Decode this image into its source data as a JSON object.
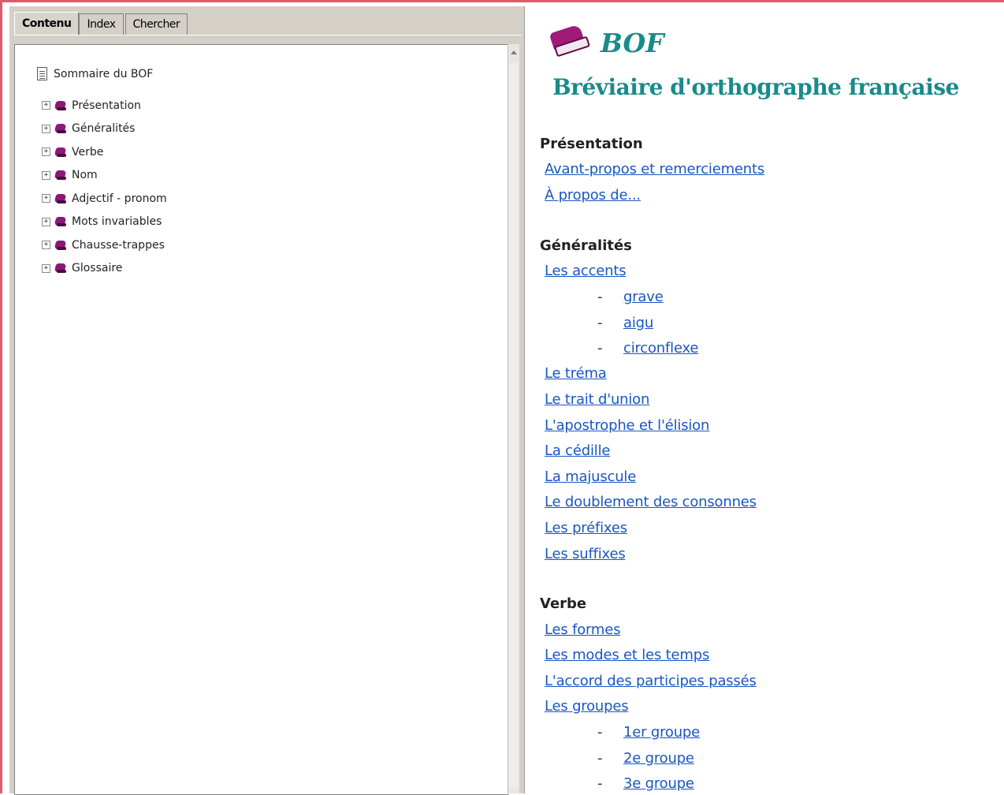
{
  "tabs": [
    "Contenu",
    "Index",
    "Chercher"
  ],
  "tree": {
    "root": "Sommaire du BOF",
    "items": [
      "Présentation",
      "Généralités",
      "Verbe",
      "Nom",
      "Adjectif - pronom",
      "Mots invariables",
      "Chausse-trappes",
      "Glossaire"
    ],
    "expander_symbol": "+"
  },
  "header": {
    "logo_text": "BOF",
    "subtitle": "Bréviaire d'orthographe française"
  },
  "sections": {
    "presentation": {
      "heading": "Présentation",
      "links": [
        "Avant-propos et remerciements",
        "À propos de..."
      ]
    },
    "generalites": {
      "heading": "Généralités",
      "links": [
        "Les accents",
        "grave",
        "aigu",
        "circonflexe",
        "Le tréma",
        "Le trait d'union",
        "L'apostrophe et l'élision",
        "La cédille",
        "La majuscule",
        "Le doublement des consonnes",
        "Les préfixes",
        "Les suffixes"
      ]
    },
    "verbe": {
      "heading": "Verbe",
      "links": [
        "Les formes",
        "Les modes et les temps",
        "L'accord des participes passés",
        "Les groupes",
        "1er groupe",
        "2e groupe",
        "3e groupe"
      ]
    }
  },
  "dash": "-",
  "colors": {
    "link": "#1a56c2",
    "title": "#1a8a8a",
    "book": "#8a1a7a",
    "frame_border": "#e05a6a"
  }
}
